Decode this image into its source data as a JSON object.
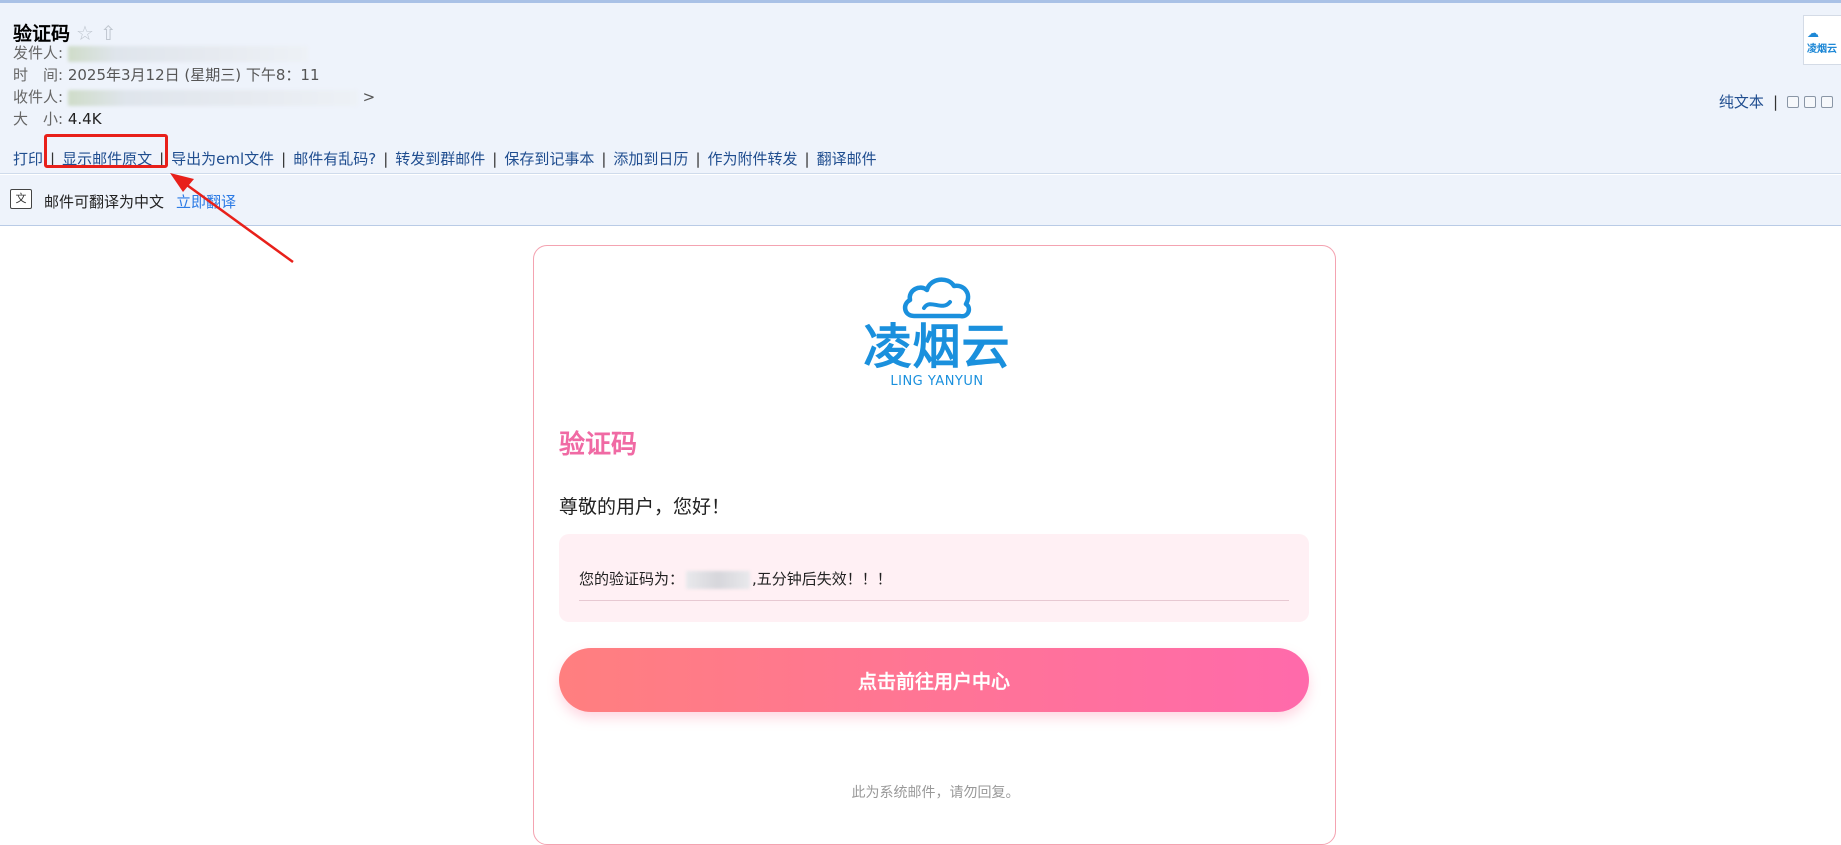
{
  "header": {
    "subject": "验证码",
    "sender_label": "发件人:",
    "time_label": "时　间:",
    "time_value": "2025年3月12日 (星期三) 下午8：11",
    "recipient_label": "收件人:",
    "recipient_suffix": ">",
    "size_label": "大　小:",
    "size_value": "4.4K",
    "plain_text_label": "纯文本"
  },
  "actions": {
    "print": "打印",
    "show_original": "显示邮件原文",
    "export_eml": "导出为eml文件",
    "garbled": "邮件有乱码?",
    "forward_group": "转发到群邮件",
    "save_note": "保存到记事本",
    "add_calendar": "添加到日历",
    "forward_attachment": "作为附件转发",
    "translate_mail": "翻译邮件"
  },
  "translate_bar": {
    "icon_glyph": "文",
    "text": "邮件可翻译为中文",
    "link": "立即翻译"
  },
  "thumb": {
    "text": "凌烟云"
  },
  "email_body": {
    "logo_text": "凌烟云",
    "logo_sub": "LING YANYUN",
    "title": "验证码",
    "greeting": "尊敬的用户，您好！",
    "code_prefix": "您的验证码为：",
    "code_suffix": ",五分钟后失效！！！",
    "button_label": "点击前往用户中心",
    "footer": "此为系统邮件，请勿回复。"
  },
  "colors": {
    "accent_pink": "#f06aa4",
    "link_blue": "#1f4d8f",
    "brand_blue": "#1a90dd",
    "highlight_red": "#e8201a"
  },
  "icons": {
    "star": "star-icon",
    "arrow_up": "arrow-up-icon",
    "translate": "translate-icon",
    "cloud": "cloud-logo-icon"
  }
}
